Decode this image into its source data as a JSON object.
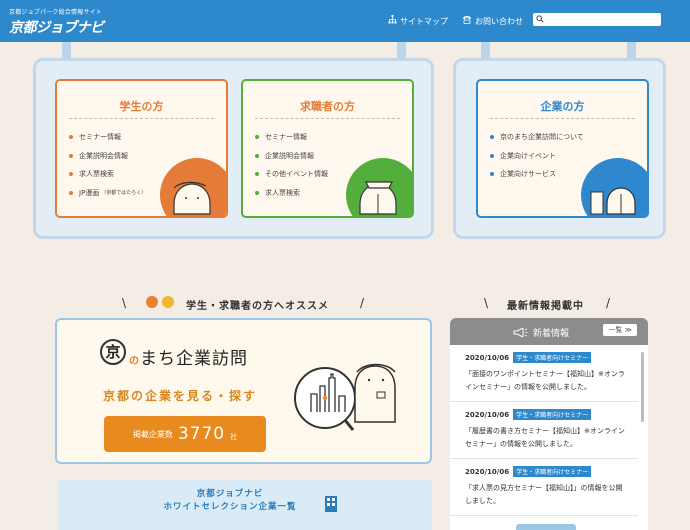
{
  "header": {
    "logo_sub": "京都ジョブパーク総合情報サイト",
    "logo_main": "京都ジョブナビ",
    "sitemap_label": "サイトマップ",
    "sitemap_icon": "sitemap-icon",
    "contact_label": "お問い合わせ",
    "contact_icon": "phone-icon",
    "search_placeholder": ""
  },
  "cards": {
    "student": {
      "title": "学生の方",
      "color": "#e57b38",
      "items": [
        "セミナー情報",
        "企業説明会情報",
        "求人票検索",
        "JP漫画"
      ],
      "jp_note": "（京都ではたらく）"
    },
    "jobseeker": {
      "title": "求職者の方",
      "color": "#53ae3c",
      "items": [
        "セミナー情報",
        "企業説明会情報",
        "その他イベント情報",
        "求人票検索"
      ]
    },
    "company": {
      "title": "企業の方",
      "color": "#2f87cd",
      "items": [
        "京のまち企業訪問について",
        "企業向けイベント",
        "企業向けサービス"
      ]
    }
  },
  "recommend": {
    "heading": "学生・求職者の方へオススメ",
    "kyo": "京",
    "title_no": "の",
    "title_rest": "まち企業訪問",
    "subtitle": "京都の企業を見る・探す",
    "count_label": "掲載企業数",
    "count_value": "3770",
    "count_unit": "社",
    "whitesel_line1": "京都ジョブナビ",
    "whitesel_line2": "ホワイトセレクション企業一覧"
  },
  "news": {
    "heading": "最新情報掲載中",
    "panel_title": "新着情報",
    "more_label": "一覧 ≫",
    "items": [
      {
        "date": "2020/10/06",
        "tag": "学生・求職者向けセミナー",
        "text": "「面接のワンポイントセミナー【福知山】※オンラインセミナー」の情報を公開しました。"
      },
      {
        "date": "2020/10/06",
        "tag": "学生・求職者向けセミナー",
        "text": "「履歴書の書き方セミナー【福知山】※オンラインセミナー」の情報を公開しました。"
      },
      {
        "date": "2020/10/06",
        "tag": "学生・求職者向けセミナー",
        "text": "「求人票の見方セミナー【福知山】」の情報を公開しました。"
      }
    ]
  }
}
